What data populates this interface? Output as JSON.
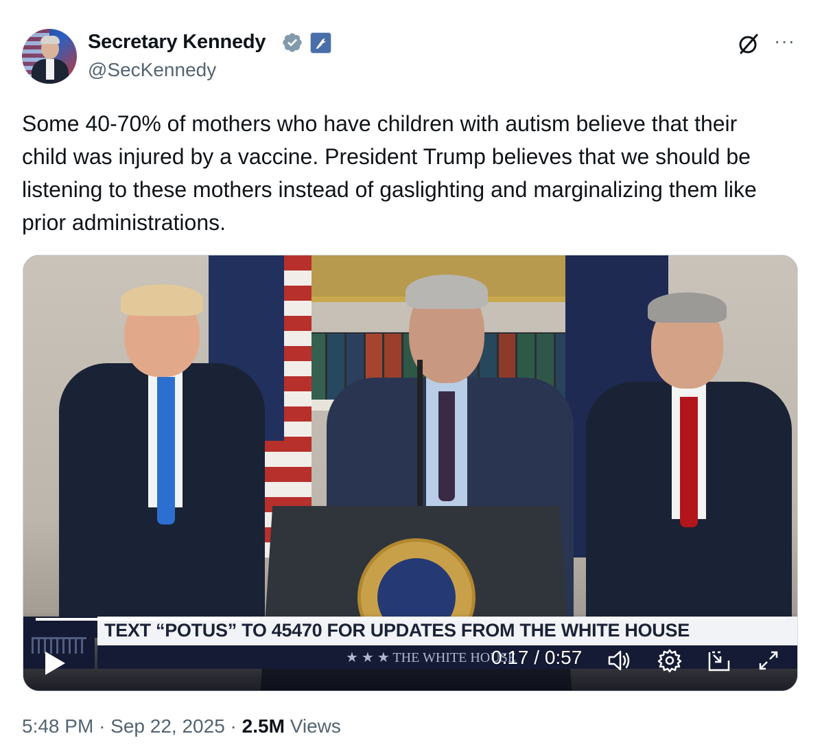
{
  "author": {
    "display_name": "Secretary Kennedy",
    "handle": "@SecKennedy",
    "verified_icon": "verified-badge-icon",
    "affiliation_icon": "hhs-affiliation-badge-icon"
  },
  "header_actions": {
    "grok_icon": "grok-icon",
    "more_label": "···"
  },
  "tweet": {
    "text": "Some 40-70% of mothers who have children with autism believe that their child was injured by a vaccine. President Trump believes that we should be listening to these mothers instead of gaslighting and marginalizing them like prior administrations."
  },
  "video": {
    "banner_text": "TEXT “POTUS” TO 45470 FOR UPDATES FROM THE WHITE HOUSE",
    "sub_banner_text": "★ ★ ★   THE WHITE HOUSE",
    "time_display": "0:17 / 0:57",
    "progress": 0.298,
    "controls": [
      "play-icon",
      "volume-icon",
      "settings-icon",
      "pip-icon",
      "fullscreen-icon"
    ]
  },
  "footer": {
    "time": "5:48 PM",
    "date": "Sep 22, 2025",
    "views_count": "2.5M",
    "views_label": "Views"
  },
  "colors": {
    "text_primary": "#0f1419",
    "text_secondary": "#536471",
    "verified_blue": "#1d9bf0",
    "border": "#cfd9de"
  }
}
